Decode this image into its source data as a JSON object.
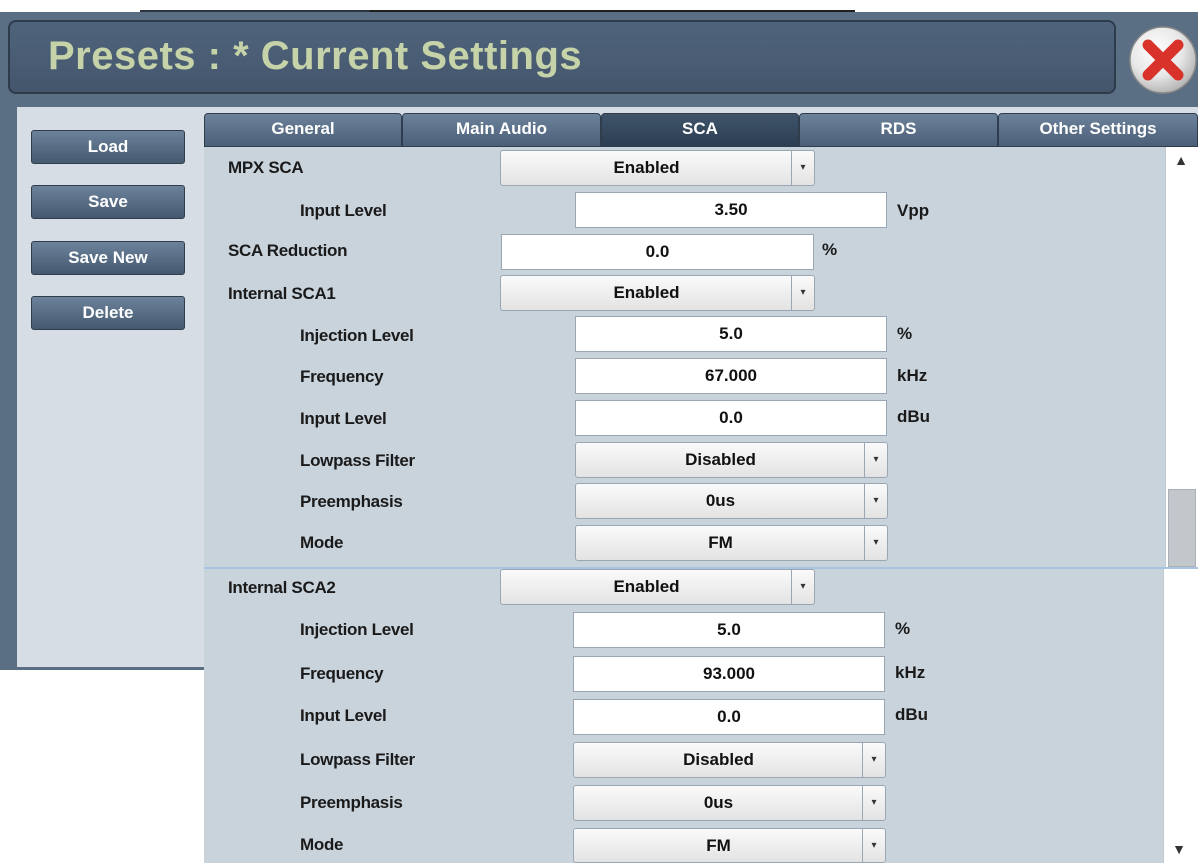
{
  "title": "Presets : *  Current Settings",
  "close_icon": "close-icon",
  "sidebar": [
    {
      "label": "Load"
    },
    {
      "label": "Save"
    },
    {
      "label": "Save New"
    },
    {
      "label": "Delete"
    }
  ],
  "tabs": [
    {
      "label": "General"
    },
    {
      "label": "Main Audio"
    },
    {
      "label": "SCA"
    },
    {
      "label": "RDS"
    },
    {
      "label": "Other Settings"
    }
  ],
  "active_tab": "SCA",
  "panel1": {
    "mpx_sca": {
      "label": "MPX SCA",
      "value": "Enabled"
    },
    "mpx_input_level": {
      "label": "Input Level",
      "value": "3.50",
      "unit": "Vpp"
    },
    "sca_reduction": {
      "label": "SCA Reduction",
      "value": "0.0",
      "unit": "%"
    },
    "internal_sca1": {
      "label": "Internal SCA1",
      "value": "Enabled"
    },
    "injection_level": {
      "label": "Injection Level",
      "value": "5.0",
      "unit": "%"
    },
    "frequency": {
      "label": "Frequency",
      "value": "67.000",
      "unit": "kHz"
    },
    "input_level": {
      "label": "Input Level",
      "value": "0.0",
      "unit": "dBu"
    },
    "lowpass_filter": {
      "label": "Lowpass Filter",
      "value": "Disabled"
    },
    "preemphasis": {
      "label": "Preemphasis",
      "value": "0us"
    },
    "mode": {
      "label": "Mode",
      "value": "FM"
    }
  },
  "panel2": {
    "internal_sca2": {
      "label": "Internal SCA2",
      "value": "Enabled"
    },
    "injection_level": {
      "label": "Injection Level",
      "value": "5.0",
      "unit": "%"
    },
    "frequency": {
      "label": "Frequency",
      "value": "93.000",
      "unit": "kHz"
    },
    "input_level": {
      "label": "Input Level",
      "value": "0.0",
      "unit": "dBu"
    },
    "lowpass_filter": {
      "label": "Lowpass Filter",
      "value": "Disabled"
    },
    "preemphasis": {
      "label": "Preemphasis",
      "value": "0us"
    },
    "mode": {
      "label": "Mode",
      "value": "FM"
    }
  },
  "scroll_icons": {
    "up": "▲",
    "down": "▼",
    "dropdown": "▾"
  }
}
